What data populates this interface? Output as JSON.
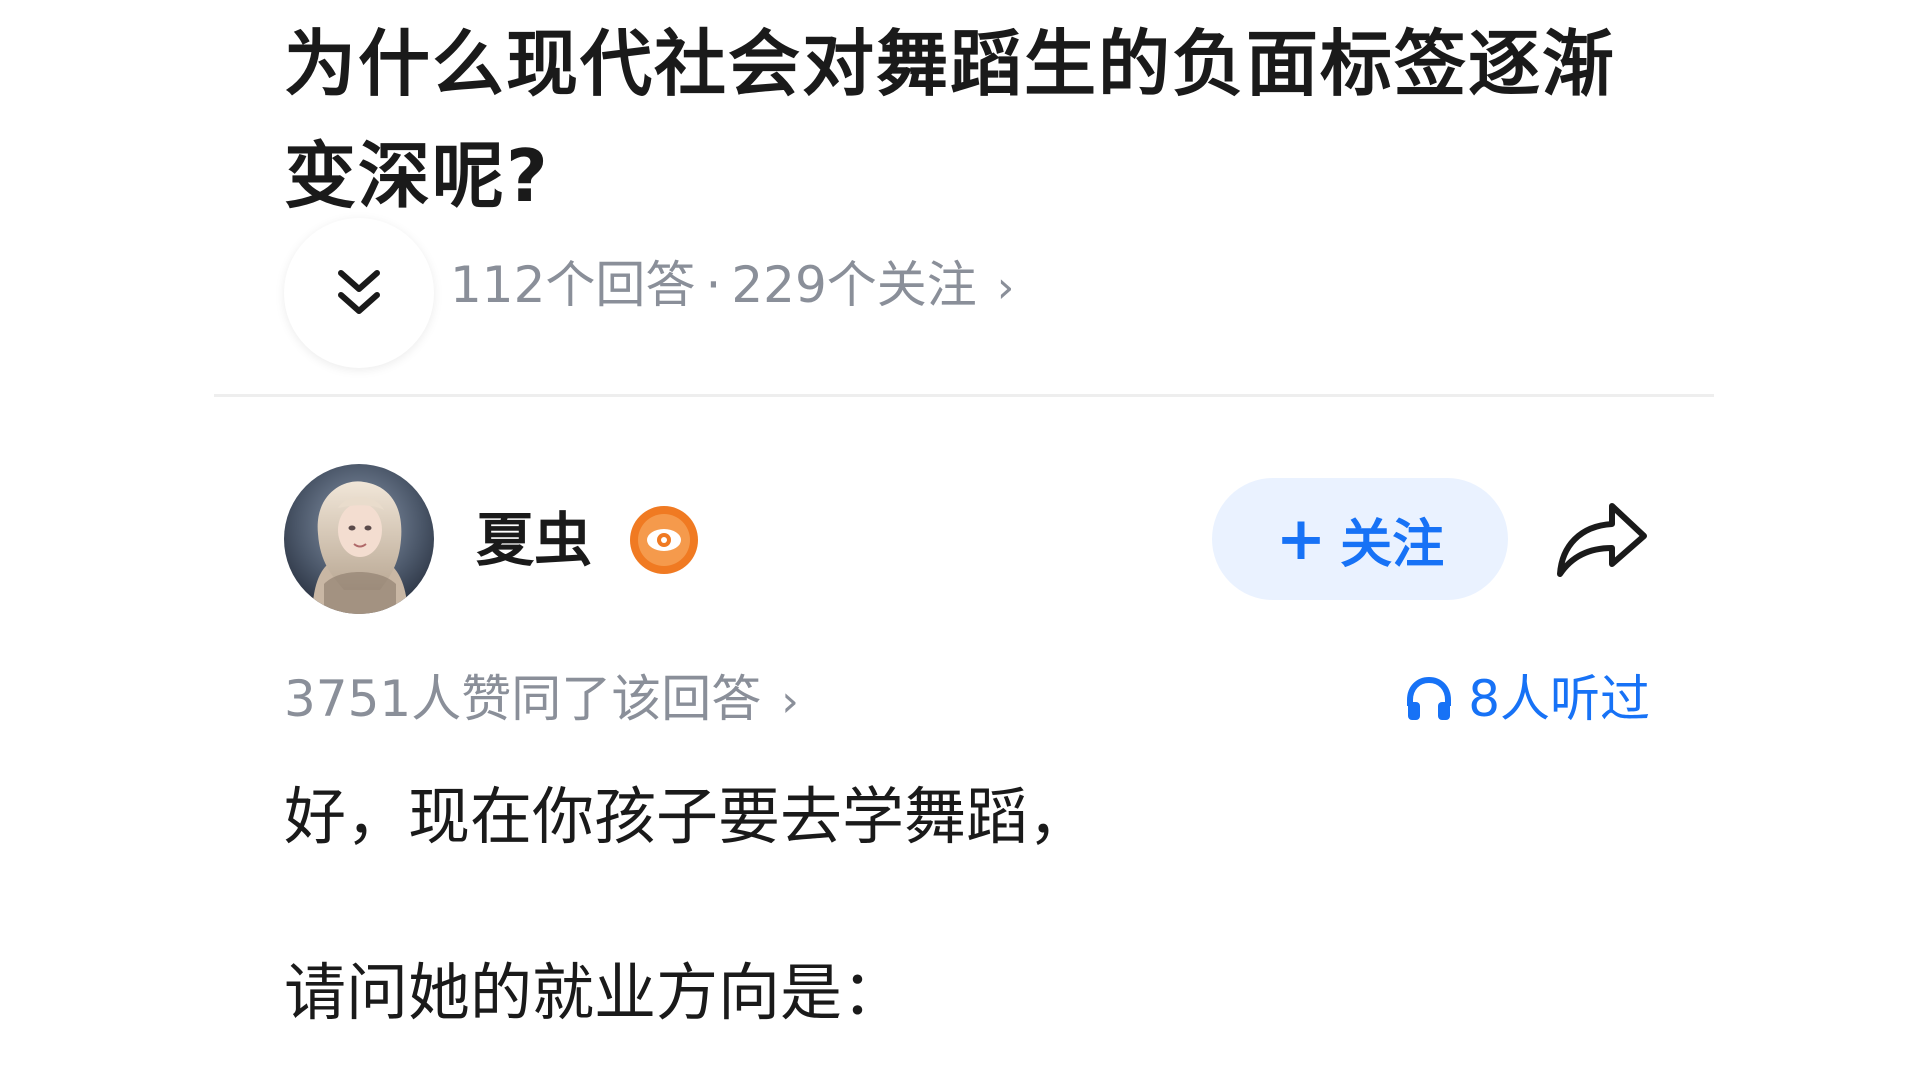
{
  "question": {
    "title": "为什么现代社会对舞蹈生的负面标签逐渐变深呢?",
    "answer_count": "112个回答",
    "separator": "·",
    "follower_count": "229个关注",
    "meta_chevron": "›"
  },
  "author": {
    "name": "夏虫",
    "badge_icon": "orange-eye-badge",
    "follow_label": "关注",
    "follow_plus": "+"
  },
  "answer": {
    "upvotes": "3751人赞同了该回答",
    "upvotes_chevron": "›",
    "listen_count": "8人听过",
    "paragraphs": [
      "好，现在你孩子要去学舞蹈，",
      "请问她的就业方向是："
    ]
  },
  "colors": {
    "accent": "#1772f6",
    "follow_bg": "#eaf2ff",
    "meta_gray": "#8a8f99",
    "badge_orange": "#f07a22"
  }
}
